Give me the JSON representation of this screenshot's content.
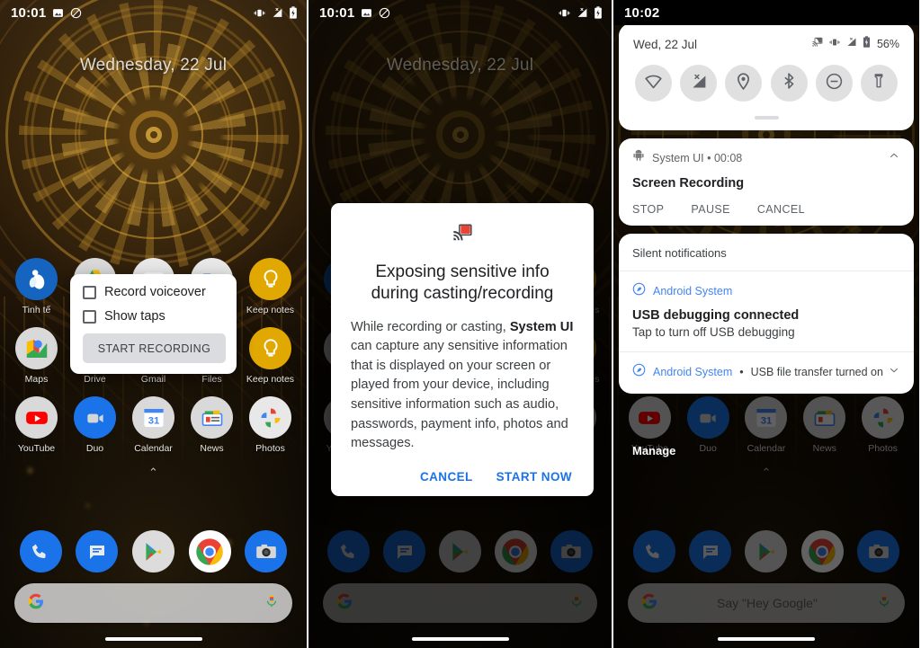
{
  "panels": [
    {
      "id": "panel-record-options",
      "statusbar": {
        "time": "10:01",
        "icons": [
          "image-icon",
          "do-not-disturb-icon"
        ],
        "right_icons": [
          "vibrate-icon",
          "no-sim-signal-icon",
          "battery-icon"
        ]
      },
      "date": "Wednesday, 22 Jul",
      "popup": {
        "checkboxes": [
          {
            "label": "Record voiceover",
            "checked": false
          },
          {
            "label": "Show taps",
            "checked": false
          }
        ],
        "button": "START RECORDING"
      },
      "search": {
        "text": ""
      }
    },
    {
      "id": "panel-cast-warning",
      "statusbar": {
        "time": "10:01",
        "icons": [
          "image-icon",
          "do-not-disturb-icon"
        ],
        "right_icons": [
          "vibrate-icon",
          "no-sim-signal-icon",
          "battery-icon"
        ]
      },
      "date": "Wednesday, 22 Jul",
      "dialog": {
        "icon": "cast-icon",
        "title": "Exposing sensitive info during casting/recording",
        "body_pre": "While recording or casting, ",
        "body_bold": "System UI",
        "body_post": " can capture any sensitive information that is displayed on your screen or played from your device, including sensitive information such as audio, passwords, payment info, photos and messages.",
        "cancel": "CANCEL",
        "confirm": "START NOW"
      },
      "search": {
        "text": ""
      }
    },
    {
      "id": "panel-notification-shade",
      "statusbar": {
        "time": "10:02"
      },
      "quick_settings": {
        "date": "Wed, 22 Jul",
        "battery": "56%",
        "status_icons": [
          "cast-icon",
          "vibrate-icon",
          "no-sim-signal-icon",
          "battery-icon"
        ],
        "tiles": [
          {
            "name": "wifi-icon"
          },
          {
            "name": "mobile-data-off-icon"
          },
          {
            "name": "location-icon"
          },
          {
            "name": "bluetooth-icon"
          },
          {
            "name": "do-not-disturb-icon"
          },
          {
            "name": "flashlight-icon"
          }
        ]
      },
      "recording_notification": {
        "app": "System UI • 00:08",
        "title": "Screen Recording",
        "actions": [
          "STOP",
          "PAUSE",
          "CANCEL"
        ]
      },
      "silent": {
        "header": "Silent notifications",
        "items": [
          {
            "app": "Android System",
            "title": "USB debugging connected",
            "desc": "Tap to turn off USB debugging",
            "collapsed": false
          },
          {
            "app": "Android System",
            "summary": "USB file transfer turned on",
            "collapsed": true
          }
        ]
      },
      "manage": "Manage",
      "search": {
        "text": "Say \"Hey Google\""
      }
    }
  ],
  "home": {
    "rows": [
      [
        {
          "label": "Tinh tế",
          "icon": "tinhte-icon"
        },
        {
          "label": "Drive",
          "icon": "drive-icon"
        },
        {
          "label": "Gmail",
          "icon": "gmail-icon"
        },
        {
          "label": "Files",
          "icon": "files-icon"
        },
        {
          "label": "Keep notes",
          "icon": "keep-icon"
        }
      ],
      [
        {
          "label": "Maps",
          "icon": "maps-icon"
        },
        {
          "label": "Drive",
          "icon": "drive-icon"
        },
        {
          "label": "Gmail",
          "icon": "gmail-icon"
        },
        {
          "label": "Files",
          "icon": "files-icon"
        },
        {
          "label": "Keep notes",
          "icon": "keep-icon"
        }
      ],
      [
        {
          "label": "YouTube",
          "icon": "youtube-icon"
        },
        {
          "label": "Duo",
          "icon": "duo-icon"
        },
        {
          "label": "Calendar",
          "icon": "calendar-icon"
        },
        {
          "label": "News",
          "icon": "news-icon"
        },
        {
          "label": "Photos",
          "icon": "photos-icon"
        }
      ]
    ],
    "page_arrow": "⌃",
    "dock": [
      {
        "label": "Phone",
        "icon": "phone-icon"
      },
      {
        "label": "Messages",
        "icon": "messages-icon"
      },
      {
        "label": "Play Store",
        "icon": "play-store-icon"
      },
      {
        "label": "Chrome",
        "icon": "chrome-icon"
      },
      {
        "label": "Camera",
        "icon": "camera-icon"
      }
    ],
    "calendar_day": "31"
  },
  "colors": {
    "accent_blue": "#1a73e8",
    "link_blue": "#4285f4",
    "wallpaper_gold": "#c9942f",
    "card_white": "#ffffff"
  }
}
